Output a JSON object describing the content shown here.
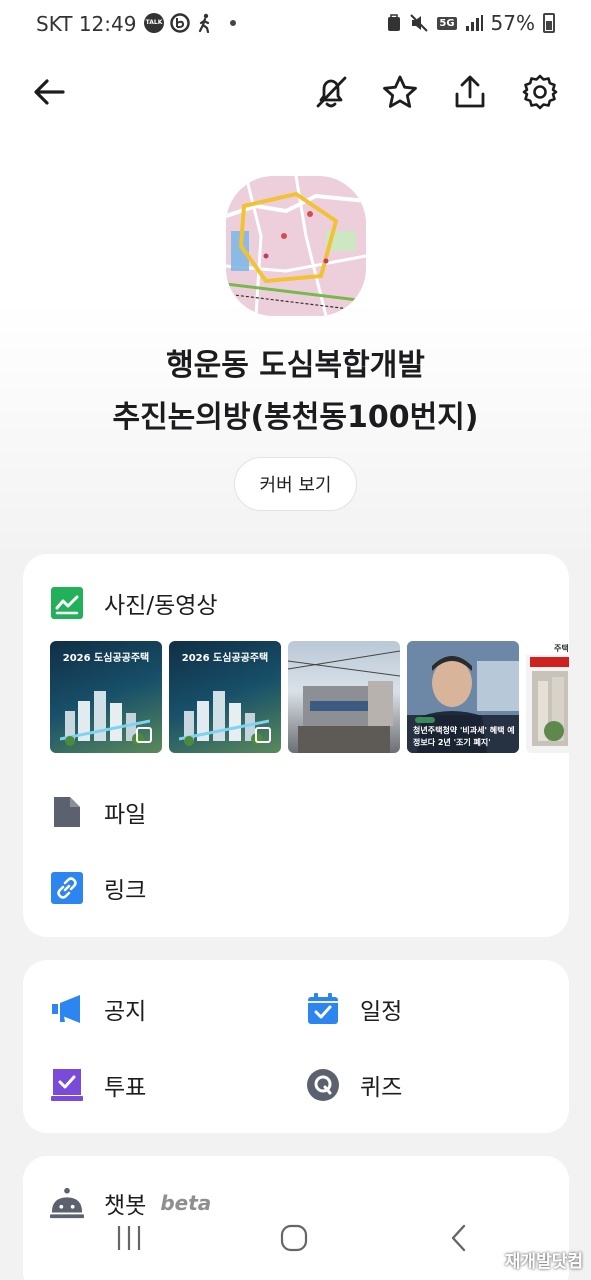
{
  "status_bar": {
    "time": "SKT 12:49",
    "notification_icons": [
      "talk-icon",
      "b-icon",
      "walking-icon"
    ],
    "network": "5G",
    "battery": "57%"
  },
  "toolbar": {
    "icons": [
      "back-arrow-icon",
      "notification-off-icon",
      "star-icon",
      "share-icon",
      "settings-icon"
    ]
  },
  "room": {
    "title_line1": "행운동 도심복합개발",
    "title_line2": "추진논의방(봉천동100번지)",
    "cover_button": "커버 보기"
  },
  "media_card": {
    "photos_label": "사진/동영상",
    "thumbnails": [
      {
        "title": "2026 도심공공주택",
        "type": "poster"
      },
      {
        "title": "2026 도심공공주택",
        "type": "poster"
      },
      {
        "title": "",
        "type": "photo"
      },
      {
        "title": "청년주택청약 '비과세' 혜택 예정보다 2년 '조기 폐지'",
        "type": "news"
      },
      {
        "title": "주택발",
        "type": "article"
      }
    ],
    "file_label": "파일",
    "link_label": "링크"
  },
  "features_card": {
    "notice_label": "공지",
    "schedule_label": "일정",
    "vote_label": "투표",
    "quiz_label": "퀴즈"
  },
  "chatbot_card": {
    "label": "챗봇",
    "badge": "beta"
  },
  "colors": {
    "accent_green": "#22b159",
    "accent_blue": "#2d86f0",
    "accent_purple": "#7a4bdb",
    "icon_gray": "#5c6170"
  },
  "watermark": "재개발닷컴"
}
